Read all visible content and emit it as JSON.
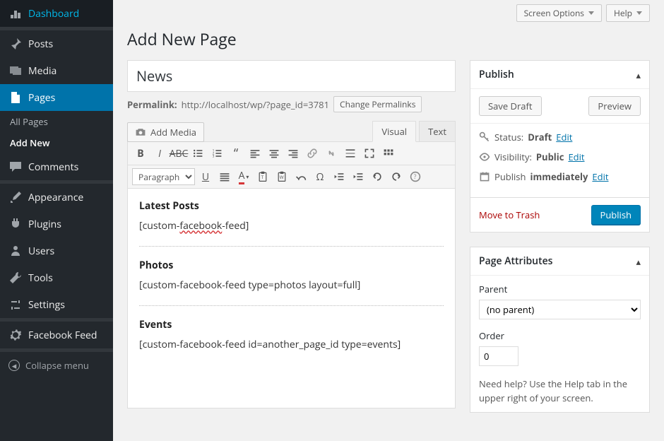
{
  "topbar": {
    "screen_options": "Screen Options",
    "help": "Help"
  },
  "sidebar": {
    "items": [
      {
        "key": "dashboard",
        "label": "Dashboard"
      },
      {
        "key": "posts",
        "label": "Posts"
      },
      {
        "key": "media",
        "label": "Media"
      },
      {
        "key": "pages",
        "label": "Pages",
        "current": true,
        "sub": [
          {
            "key": "all-pages",
            "label": "All Pages"
          },
          {
            "key": "add-new",
            "label": "Add New",
            "current": true
          }
        ]
      },
      {
        "key": "comments",
        "label": "Comments"
      },
      {
        "key": "appearance",
        "label": "Appearance"
      },
      {
        "key": "plugins",
        "label": "Plugins"
      },
      {
        "key": "users",
        "label": "Users"
      },
      {
        "key": "tools",
        "label": "Tools"
      },
      {
        "key": "settings",
        "label": "Settings"
      },
      {
        "key": "facebook-feed",
        "label": "Facebook Feed"
      }
    ],
    "collapse": "Collapse menu"
  },
  "page": {
    "heading": "Add New Page",
    "title_value": "News",
    "permalink_label": "Permalink:",
    "permalink_url": "http://localhost/wp/?page_id=3781",
    "change_permalinks": "Change Permalinks",
    "add_media": "Add Media",
    "tabs": {
      "visual": "Visual",
      "text": "Text"
    },
    "format_select": "Paragraph",
    "content": {
      "h1": "Latest Posts",
      "p1_pre": "[custom-",
      "p1_err": "facebook",
      "p1_post": "-feed]",
      "h2": "Photos",
      "p2": "[custom-facebook-feed type=photos layout=full]",
      "h3": "Events",
      "p3": "[custom-facebook-feed id=another_page_id type=events]"
    }
  },
  "publish": {
    "title": "Publish",
    "save_draft": "Save Draft",
    "preview": "Preview",
    "status_label": "Status:",
    "status_value": "Draft",
    "visibility_label": "Visibility:",
    "visibility_value": "Public",
    "schedule_label": "Publish",
    "schedule_value": "immediately",
    "edit": "Edit",
    "trash": "Move to Trash",
    "publish_btn": "Publish"
  },
  "attributes": {
    "title": "Page Attributes",
    "parent_label": "Parent",
    "parent_value": "(no parent)",
    "order_label": "Order",
    "order_value": "0",
    "help": "Need help? Use the Help tab in the upper right of your screen."
  }
}
